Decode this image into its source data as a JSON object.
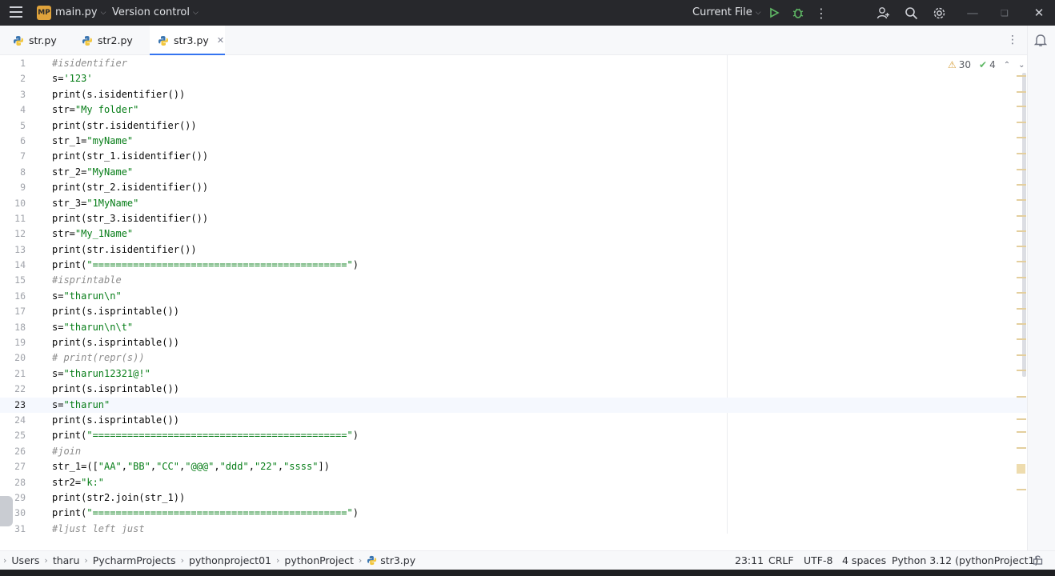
{
  "titlebar": {
    "project_badge": "MP",
    "project_name": "main.py",
    "vcs_label": "Version control",
    "run_config": "Current File",
    "icons": [
      "hamburger-menu-icon",
      "run-icon",
      "debug-icon",
      "more-vertical-icon",
      "add-user-icon",
      "search-icon",
      "gear-icon",
      "minimize-icon",
      "restore-icon",
      "close-icon"
    ]
  },
  "tabs": [
    {
      "label": "str.py",
      "active": false
    },
    {
      "label": "str2.py",
      "active": false
    },
    {
      "label": "str3.py",
      "active": true
    }
  ],
  "inspections": {
    "warnings": "30",
    "ok": "4"
  },
  "editor": {
    "current_line": 23,
    "lines": [
      {
        "n": "1",
        "text": "#isidentifier"
      },
      {
        "n": "2",
        "text": "s='123'"
      },
      {
        "n": "3",
        "text": "print(s.isidentifier())"
      },
      {
        "n": "4",
        "text": "str=\"My folder\""
      },
      {
        "n": "5",
        "text": "print(str.isidentifier())"
      },
      {
        "n": "6",
        "text": "str_1=\"myName\""
      },
      {
        "n": "7",
        "text": "print(str_1.isidentifier())"
      },
      {
        "n": "8",
        "text": "str_2=\"MyName\""
      },
      {
        "n": "9",
        "text": "print(str_2.isidentifier())"
      },
      {
        "n": "10",
        "text": "str_3=\"1MyName\""
      },
      {
        "n": "11",
        "text": "print(str_3.isidentifier())"
      },
      {
        "n": "12",
        "text": "str=\"My_1Name\""
      },
      {
        "n": "13",
        "text": "print(str.isidentifier())"
      },
      {
        "n": "14",
        "text": "print(\"============================================\")"
      },
      {
        "n": "15",
        "text": "#isprintable"
      },
      {
        "n": "16",
        "text": "s=\"tharun\\n\""
      },
      {
        "n": "17",
        "text": "print(s.isprintable())"
      },
      {
        "n": "18",
        "text": "s=\"tharun\\n\\t\""
      },
      {
        "n": "19",
        "text": "print(s.isprintable())"
      },
      {
        "n": "20",
        "text": "# print(repr(s))"
      },
      {
        "n": "21",
        "text": "s=\"tharun12321@!\""
      },
      {
        "n": "22",
        "text": "print(s.isprintable())"
      },
      {
        "n": "23",
        "text": "s=\"tharun\""
      },
      {
        "n": "24",
        "text": "print(s.isprintable())"
      },
      {
        "n": "25",
        "text": "print(\"============================================\")"
      },
      {
        "n": "26",
        "text": "#join"
      },
      {
        "n": "27",
        "text": "str_1=([\"AA\",\"BB\",\"CC\",\"@@@\",\"ddd\",\"22\",\"ssss\"])"
      },
      {
        "n": "28",
        "text": "str2=\"k:\""
      },
      {
        "n": "29",
        "text": "print(str2.join(str_1))"
      },
      {
        "n": "30",
        "text": "print(\"============================================\")"
      },
      {
        "n": "31",
        "text": "#ljust left just"
      }
    ]
  },
  "breadcrumb": [
    "Users",
    "tharu",
    "PycharmProjects",
    "pythonproject01",
    "pythonProject",
    "str3.py"
  ],
  "status": {
    "position": "23:11",
    "line_sep": "CRLF",
    "encoding": "UTF-8",
    "indent": "4 spaces",
    "interpreter": "Python 3.12 (pythonProject1)"
  },
  "colors": {
    "accent": "#3574f0",
    "string": "#067d17",
    "comment": "#8c8c8c",
    "titlebar": "#27282c"
  }
}
